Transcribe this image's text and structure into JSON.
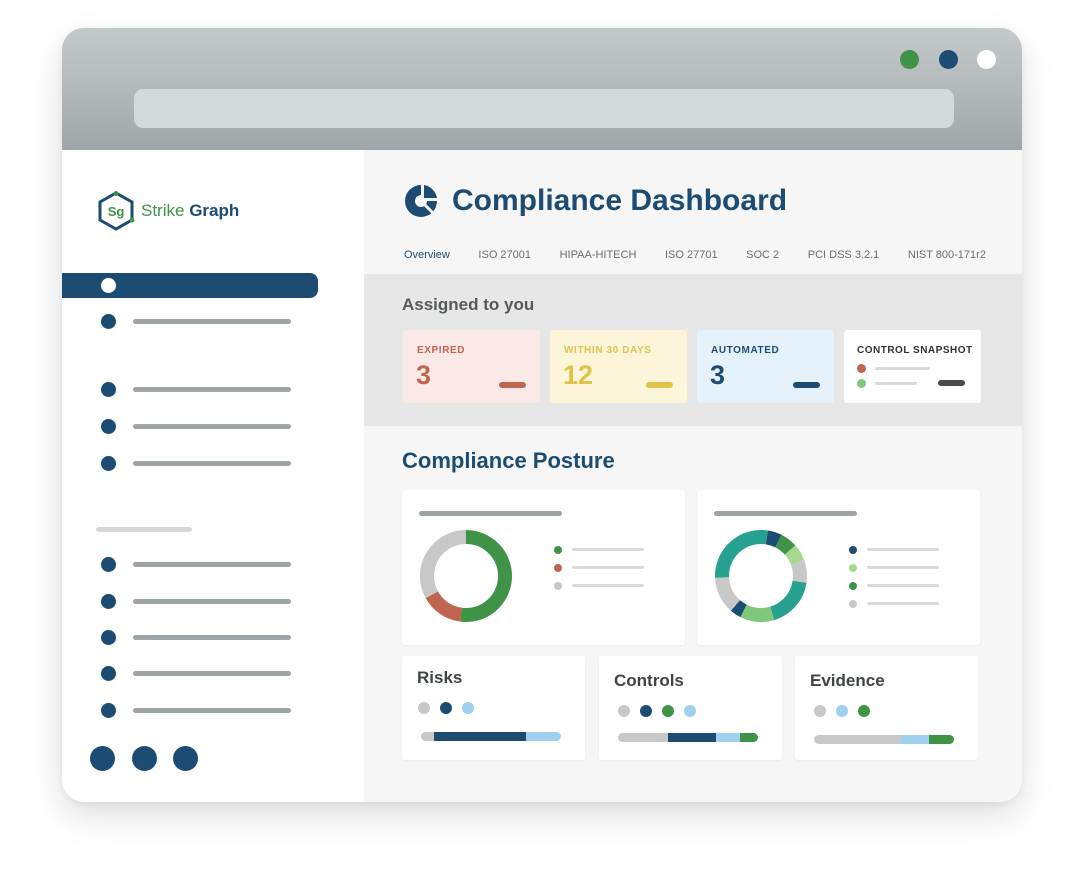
{
  "window": {
    "controls": [
      {
        "name": "green-window-dot",
        "color": "#3f9346"
      },
      {
        "name": "blue-window-dot",
        "color": "#1d4c72"
      },
      {
        "name": "white-window-dot",
        "color": "#ffffff"
      }
    ]
  },
  "brand": {
    "logo_mark": "Sg",
    "name_part1": "Strike",
    "name_part2": "Graph",
    "colors": {
      "green": "#3f9346",
      "navy": "#1d4c72"
    }
  },
  "header": {
    "icon": "pie-chart-icon",
    "title": "Compliance Dashboard"
  },
  "tabs": [
    {
      "label": "Overview",
      "active": true
    },
    {
      "label": "ISO 27001",
      "active": false
    },
    {
      "label": "HIPAA-HITECH",
      "active": false
    },
    {
      "label": "ISO 27701",
      "active": false
    },
    {
      "label": "SOC 2",
      "active": false
    },
    {
      "label": "PCI DSS 3.2.1",
      "active": false
    },
    {
      "label": "NIST 800-171r2",
      "active": false
    }
  ],
  "assigned": {
    "heading": "Assigned to you",
    "cards": [
      {
        "label": "EXPIRED",
        "value": "3",
        "bg": "#fbe9e7",
        "color": "#c0654f"
      },
      {
        "label": "WITHIN 30 DAYS",
        "value": "12",
        "bg": "#fcf5d9",
        "color": "#e0c34a"
      },
      {
        "label": "AUTOMATED",
        "value": "3",
        "bg": "#e5f2fc",
        "color": "#1d4c72"
      }
    ],
    "snapshot": {
      "label": "CONTROL SNAPSHOT"
    }
  },
  "posture": {
    "title": "Compliance Posture",
    "donut1": {
      "segments": [
        {
          "fraction": 0.52,
          "color": "#3f9346"
        },
        {
          "fraction": 0.15,
          "color": "#c0654f"
        },
        {
          "fraction": 0.33,
          "color": "#c8c8c8"
        }
      ],
      "legend_colors": [
        "#3f9346",
        "#c0654f",
        "#c8c8c8"
      ]
    },
    "donut2": {
      "segments": [
        {
          "fraction": 0.05,
          "color": "#1d4c72"
        },
        {
          "fraction": 0.06,
          "color": "#3f9346"
        },
        {
          "fraction": 0.06,
          "color": "#a6d98e"
        },
        {
          "fraction": 0.08,
          "color": "#c8c8c8"
        },
        {
          "fraction": 0.18,
          "color": "#26a08f"
        },
        {
          "fraction": 0.12,
          "color": "#7fc77b"
        },
        {
          "fraction": 0.04,
          "color": "#1d4c72"
        },
        {
          "fraction": 0.13,
          "color": "#c8c8c8"
        },
        {
          "fraction": 0.28,
          "color": "#26a08f"
        }
      ],
      "legend_colors": [
        "#1d4c72",
        "#a6d98e",
        "#3f9346",
        "#c8c8c8"
      ]
    }
  },
  "summaries": [
    {
      "title": "Risks",
      "dots": [
        "#c8c8c8",
        "#1d4c72",
        "#9fd0ef"
      ],
      "bar": [
        {
          "fraction": 0.09,
          "color": "#c8c8c8"
        },
        {
          "fraction": 0.66,
          "color": "#1d4c72"
        },
        {
          "fraction": 0.25,
          "color": "#9fd0ef"
        }
      ]
    },
    {
      "title": "Controls",
      "dots": [
        "#c8c8c8",
        "#1d4c72",
        "#3f9346",
        "#9fd0ef"
      ],
      "bar": [
        {
          "fraction": 0.36,
          "color": "#c8c8c8"
        },
        {
          "fraction": 0.34,
          "color": "#1d4c72"
        },
        {
          "fraction": 0.17,
          "color": "#9fd0ef"
        },
        {
          "fraction": 0.13,
          "color": "#3f9346"
        }
      ]
    },
    {
      "title": "Evidence",
      "dots": [
        "#c8c8c8",
        "#9fd0ef",
        "#3f9346"
      ],
      "bar": [
        {
          "fraction": 0.62,
          "color": "#c8c8c8"
        },
        {
          "fraction": 0.2,
          "color": "#9fd0ef"
        },
        {
          "fraction": 0.18,
          "color": "#3f9346"
        }
      ]
    }
  ],
  "sidebar": {
    "footer_icons": [
      "footer-circle-icon",
      "footer-circle-icon",
      "footer-circle-icon"
    ]
  }
}
